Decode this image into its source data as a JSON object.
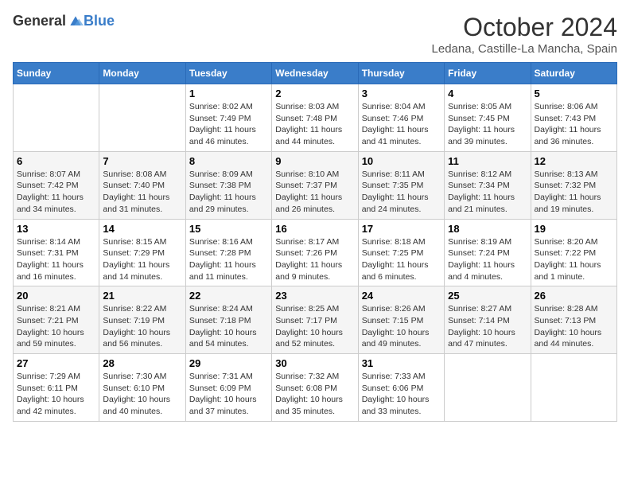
{
  "header": {
    "logo_general": "General",
    "logo_blue": "Blue",
    "month": "October 2024",
    "location": "Ledana, Castille-La Mancha, Spain"
  },
  "weekdays": [
    "Sunday",
    "Monday",
    "Tuesday",
    "Wednesday",
    "Thursday",
    "Friday",
    "Saturday"
  ],
  "weeks": [
    [
      {
        "day": "",
        "info": ""
      },
      {
        "day": "",
        "info": ""
      },
      {
        "day": "1",
        "info": "Sunrise: 8:02 AM\nSunset: 7:49 PM\nDaylight: 11 hours and 46 minutes."
      },
      {
        "day": "2",
        "info": "Sunrise: 8:03 AM\nSunset: 7:48 PM\nDaylight: 11 hours and 44 minutes."
      },
      {
        "day": "3",
        "info": "Sunrise: 8:04 AM\nSunset: 7:46 PM\nDaylight: 11 hours and 41 minutes."
      },
      {
        "day": "4",
        "info": "Sunrise: 8:05 AM\nSunset: 7:45 PM\nDaylight: 11 hours and 39 minutes."
      },
      {
        "day": "5",
        "info": "Sunrise: 8:06 AM\nSunset: 7:43 PM\nDaylight: 11 hours and 36 minutes."
      }
    ],
    [
      {
        "day": "6",
        "info": "Sunrise: 8:07 AM\nSunset: 7:42 PM\nDaylight: 11 hours and 34 minutes."
      },
      {
        "day": "7",
        "info": "Sunrise: 8:08 AM\nSunset: 7:40 PM\nDaylight: 11 hours and 31 minutes."
      },
      {
        "day": "8",
        "info": "Sunrise: 8:09 AM\nSunset: 7:38 PM\nDaylight: 11 hours and 29 minutes."
      },
      {
        "day": "9",
        "info": "Sunrise: 8:10 AM\nSunset: 7:37 PM\nDaylight: 11 hours and 26 minutes."
      },
      {
        "day": "10",
        "info": "Sunrise: 8:11 AM\nSunset: 7:35 PM\nDaylight: 11 hours and 24 minutes."
      },
      {
        "day": "11",
        "info": "Sunrise: 8:12 AM\nSunset: 7:34 PM\nDaylight: 11 hours and 21 minutes."
      },
      {
        "day": "12",
        "info": "Sunrise: 8:13 AM\nSunset: 7:32 PM\nDaylight: 11 hours and 19 minutes."
      }
    ],
    [
      {
        "day": "13",
        "info": "Sunrise: 8:14 AM\nSunset: 7:31 PM\nDaylight: 11 hours and 16 minutes."
      },
      {
        "day": "14",
        "info": "Sunrise: 8:15 AM\nSunset: 7:29 PM\nDaylight: 11 hours and 14 minutes."
      },
      {
        "day": "15",
        "info": "Sunrise: 8:16 AM\nSunset: 7:28 PM\nDaylight: 11 hours and 11 minutes."
      },
      {
        "day": "16",
        "info": "Sunrise: 8:17 AM\nSunset: 7:26 PM\nDaylight: 11 hours and 9 minutes."
      },
      {
        "day": "17",
        "info": "Sunrise: 8:18 AM\nSunset: 7:25 PM\nDaylight: 11 hours and 6 minutes."
      },
      {
        "day": "18",
        "info": "Sunrise: 8:19 AM\nSunset: 7:24 PM\nDaylight: 11 hours and 4 minutes."
      },
      {
        "day": "19",
        "info": "Sunrise: 8:20 AM\nSunset: 7:22 PM\nDaylight: 11 hours and 1 minute."
      }
    ],
    [
      {
        "day": "20",
        "info": "Sunrise: 8:21 AM\nSunset: 7:21 PM\nDaylight: 10 hours and 59 minutes."
      },
      {
        "day": "21",
        "info": "Sunrise: 8:22 AM\nSunset: 7:19 PM\nDaylight: 10 hours and 56 minutes."
      },
      {
        "day": "22",
        "info": "Sunrise: 8:24 AM\nSunset: 7:18 PM\nDaylight: 10 hours and 54 minutes."
      },
      {
        "day": "23",
        "info": "Sunrise: 8:25 AM\nSunset: 7:17 PM\nDaylight: 10 hours and 52 minutes."
      },
      {
        "day": "24",
        "info": "Sunrise: 8:26 AM\nSunset: 7:15 PM\nDaylight: 10 hours and 49 minutes."
      },
      {
        "day": "25",
        "info": "Sunrise: 8:27 AM\nSunset: 7:14 PM\nDaylight: 10 hours and 47 minutes."
      },
      {
        "day": "26",
        "info": "Sunrise: 8:28 AM\nSunset: 7:13 PM\nDaylight: 10 hours and 44 minutes."
      }
    ],
    [
      {
        "day": "27",
        "info": "Sunrise: 7:29 AM\nSunset: 6:11 PM\nDaylight: 10 hours and 42 minutes."
      },
      {
        "day": "28",
        "info": "Sunrise: 7:30 AM\nSunset: 6:10 PM\nDaylight: 10 hours and 40 minutes."
      },
      {
        "day": "29",
        "info": "Sunrise: 7:31 AM\nSunset: 6:09 PM\nDaylight: 10 hours and 37 minutes."
      },
      {
        "day": "30",
        "info": "Sunrise: 7:32 AM\nSunset: 6:08 PM\nDaylight: 10 hours and 35 minutes."
      },
      {
        "day": "31",
        "info": "Sunrise: 7:33 AM\nSunset: 6:06 PM\nDaylight: 10 hours and 33 minutes."
      },
      {
        "day": "",
        "info": ""
      },
      {
        "day": "",
        "info": ""
      }
    ]
  ]
}
